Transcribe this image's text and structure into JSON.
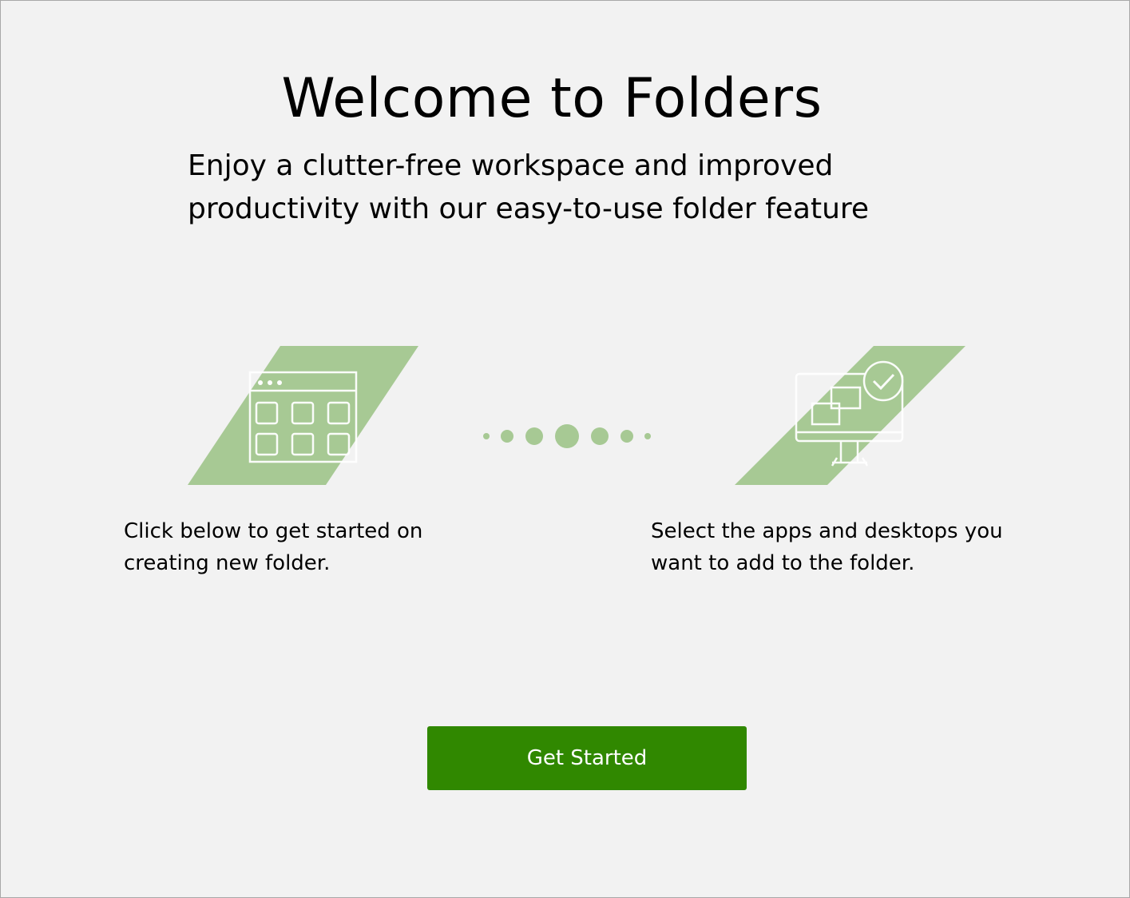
{
  "header": {
    "title": "Welcome to Folders",
    "subtitle_line1": "Enjoy a clutter-free workspace and improved",
    "subtitle_line2": "productivity with our easy-to-use folder feature"
  },
  "steps": [
    {
      "icon": "app-grid-icon",
      "line1": "Click below to get started on",
      "line2": "creating new folder."
    },
    {
      "icon": "desktop-apps-check-icon",
      "line1": "Select the apps and desktops you",
      "line2": "want to add to the folder."
    }
  ],
  "progress_dots_icon": "progress-dots-icon",
  "actions": {
    "get_started_label": "Get Started"
  },
  "colors": {
    "background": "#f2f2f2",
    "accent": "#308800",
    "illustration": "#a7c994",
    "illustration_line": "#ffffff"
  }
}
